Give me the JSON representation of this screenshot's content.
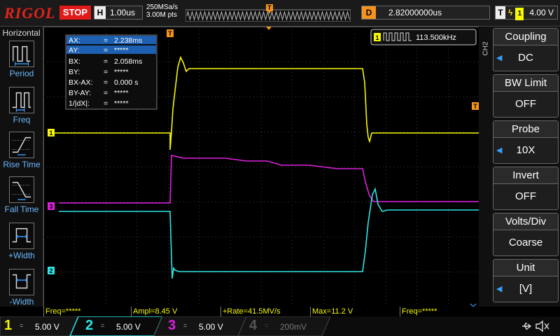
{
  "header": {
    "brand": "RIGOL",
    "run_state": "STOP",
    "timebase_key": "H",
    "timebase": "1.00us",
    "sample_rate": "250MSa/s",
    "memory_depth": "3.00M pts",
    "trigger_pos_marker": "T",
    "delay_key": "D",
    "delay": "2.82000000us",
    "trigger_key": "T",
    "trigger_source": "1",
    "trigger_level": "4.00 V"
  },
  "left_menu": {
    "title": "Horizontal",
    "items": [
      {
        "label": "Period",
        "icon": "period-icon"
      },
      {
        "label": "Freq",
        "icon": "freq-icon"
      },
      {
        "label": "Rise Time",
        "icon": "rise-time-icon"
      },
      {
        "label": "Fall Time",
        "icon": "fall-time-icon"
      },
      {
        "label": "+Width",
        "icon": "positive-width-icon"
      },
      {
        "label": "-Width",
        "icon": "negative-width-icon"
      }
    ]
  },
  "cursor_panel": {
    "rows": [
      {
        "key": "AX:",
        "eq": "=",
        "value": "2.238ms"
      },
      {
        "key": "AY:",
        "eq": "=",
        "value": "*****"
      },
      {
        "key": "BX:",
        "eq": "=",
        "value": "2.058ms"
      },
      {
        "key": "BY:",
        "eq": "=",
        "value": "*****"
      },
      {
        "key": "BX-AX:",
        "eq": "=",
        "value": "0.000 s"
      },
      {
        "key": "BY-AY:",
        "eq": "=",
        "value": "*****"
      },
      {
        "key": "1/|dX|:",
        "eq": "=",
        "value": "*****"
      }
    ]
  },
  "freq_counter": {
    "channel": "1",
    "value": "113.500kHz"
  },
  "channel_markers": {
    "ch1": "1",
    "ch2": "2",
    "ch3": "3",
    "trigger_level": "T",
    "cursor_a": "T"
  },
  "right_menu": {
    "channel_label": "CH2",
    "buttons": [
      {
        "title": "Coupling",
        "value": "DC"
      },
      {
        "title": "BW Limit",
        "value": "OFF"
      },
      {
        "title": "Probe",
        "value": "10X"
      },
      {
        "title": "Invert",
        "value": "OFF"
      },
      {
        "title": "Volts/Div",
        "value": "Coarse"
      },
      {
        "title": "Unit",
        "value": "[V]"
      }
    ]
  },
  "measurements": [
    {
      "label": "Freq=*****"
    },
    {
      "label": "Ampl=8.45 V"
    },
    {
      "label": "+Rate=41.5MV/s"
    },
    {
      "label": "Max=11.2 V"
    },
    {
      "label": "Freq=*****"
    }
  ],
  "channels": [
    {
      "num": "1",
      "coupling": "=",
      "scale": "5.00 V",
      "color": "#f7f700"
    },
    {
      "num": "2",
      "coupling": "=",
      "scale": "5.00 V",
      "color": "#2ee6e6"
    },
    {
      "num": "3",
      "coupling": "=",
      "scale": "5.00 V",
      "color": "#e020e0"
    },
    {
      "num": "4",
      "coupling": "=",
      "scale": "200mV",
      "color": "#555555"
    }
  ],
  "status_icons": [
    "usb-icon",
    "speaker-muted-icon"
  ],
  "colors": {
    "ch1": "#f7f700",
    "ch2": "#2ee6e6",
    "ch3": "#e020e0",
    "trigger": "#f7941d",
    "accent": "#39a0ff",
    "brand": "#e2231a"
  }
}
